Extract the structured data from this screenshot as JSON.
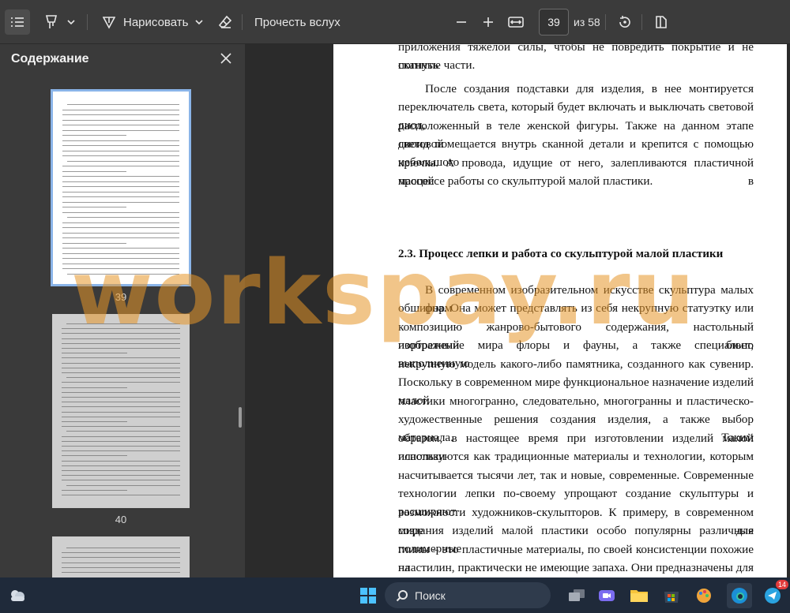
{
  "toolbar": {
    "draw_label": "Нарисовать",
    "read_aloud_label": "Прочесть вслух",
    "page_number": "39",
    "page_total": "из 58"
  },
  "sidebar": {
    "title": "Содержание",
    "thumbnails": [
      {
        "label": "39"
      },
      {
        "label": "40"
      }
    ]
  },
  "document": {
    "lines": [
      "приложения тяжелой силы, чтобы не повредить покрытие и не погнуть",
      "сканные части.",
      "После создания подставки для изделия, в нее монтируется",
      "переключатель света, который будет включать и выключать световой диод,",
      "расположенный в теле женской фигуры. Также на данном этапе световой",
      "диоид помещается внутрь сканной детали и крепится с помощью небольшого",
      "крючка. А провода, идущие от него, залепливаются пластичной массой в",
      "процессе работы со скульптурой малой пластики.",
      "В современном изобразительном искусстве скульптура малых форм",
      "обширна. Она может представлять из себя некрупную статуэтку или",
      "композицию жанрово-бытового содержания, настольный портретный бюст,",
      "изображение мира флоры и фауны, а также специально выполненную",
      "некрупную модель какого-либо памятника, созданного как сувенир.",
      "Поскольку в современном мире функциональное назначение изделий малой",
      "пластики многогранно, следовательно, многогранны и пластическо-",
      "художественные решения создания изделия, а также выбор материала. Таким",
      "образом, в настоящее время при изготовлении изделий малой пластики",
      "используются как традиционные материалы и технологии, которым",
      "насчитывается тысячи лет, так и новые, современные. Современные",
      "технологии лепки по-своему упрощают создание скульптуры и расширяют",
      "возможности художников-скульпторов. К примеру, в современном мире для",
      "создания изделий малой пластики особо популярны различные полимерные",
      "глины – это пластичные материалы, по своей консистенции похожие на",
      "пластилин, практически не имеющие запаха. Они предназначены для"
    ],
    "heading": "2.3. Процесс лепки и работа со скульптурой малой пластики"
  },
  "watermark": "workspay.ru",
  "taskbar": {
    "search_label": "Поиск",
    "telegram_badge": "14"
  },
  "colors": {
    "toolbar_bg": "#3b3b3b",
    "sidebar_bg": "#3a3a3a",
    "thumb_selected_border": "#8ab4e8",
    "watermark": "#e69628",
    "taskbar_bg": "#1f2a3a"
  }
}
